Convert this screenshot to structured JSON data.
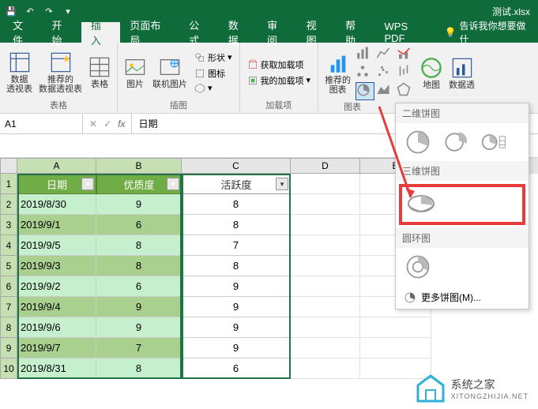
{
  "app": {
    "title": "测试.xlsx"
  },
  "qat": {
    "save": "save",
    "undo": "undo",
    "redo": "redo"
  },
  "tabs": [
    "文件",
    "开始",
    "插入",
    "页面布局",
    "公式",
    "数据",
    "审阅",
    "视图",
    "帮助",
    "WPS PDF"
  ],
  "active_tab": "插入",
  "tell_me": "告诉我你想要做什",
  "ribbon": {
    "groups": {
      "tables": {
        "label": "表格",
        "pivot": "数据\n透视表",
        "rec_pivot": "推荐的\n数据透视表",
        "table": "表格"
      },
      "illus": {
        "label": "插图",
        "pic": "图片",
        "online_pic": "联机图片",
        "shapes": "形状",
        "icons": "图标",
        "threed": "3D"
      },
      "addins": {
        "label": "加载项",
        "get": "获取加载项",
        "my": "我的加载项"
      },
      "charts": {
        "label": "图表",
        "rec": "推荐的\n图表",
        "map": "地图",
        "pivotchart": "数据透"
      }
    }
  },
  "namebox": "A1",
  "formula_value": "日期",
  "columns": [
    "A",
    "B",
    "C",
    "D",
    "E"
  ],
  "table": {
    "headers": [
      "日期",
      "优质度",
      "活跃度"
    ],
    "rows": [
      {
        "date": "2019/8/30",
        "quality": "9",
        "activity": "8"
      },
      {
        "date": "2019/9/1",
        "quality": "6",
        "activity": "8"
      },
      {
        "date": "2019/9/5",
        "quality": "8",
        "activity": "7"
      },
      {
        "date": "2019/9/3",
        "quality": "8",
        "activity": "8"
      },
      {
        "date": "2019/9/2",
        "quality": "6",
        "activity": "9"
      },
      {
        "date": "2019/9/4",
        "quality": "9",
        "activity": "9"
      },
      {
        "date": "2019/9/6",
        "quality": "9",
        "activity": "9"
      },
      {
        "date": "2019/9/7",
        "quality": "7",
        "activity": "9"
      },
      {
        "date": "2019/8/31",
        "quality": "8",
        "activity": "6"
      }
    ]
  },
  "pie_menu": {
    "sec_2d": "二维饼图",
    "sec_3d": "三维饼图",
    "sec_donut": "圆环图",
    "more": "更多饼图(M)..."
  },
  "watermark": {
    "name": "系统之家",
    "url": "XITONGZHIJIA.NET"
  }
}
